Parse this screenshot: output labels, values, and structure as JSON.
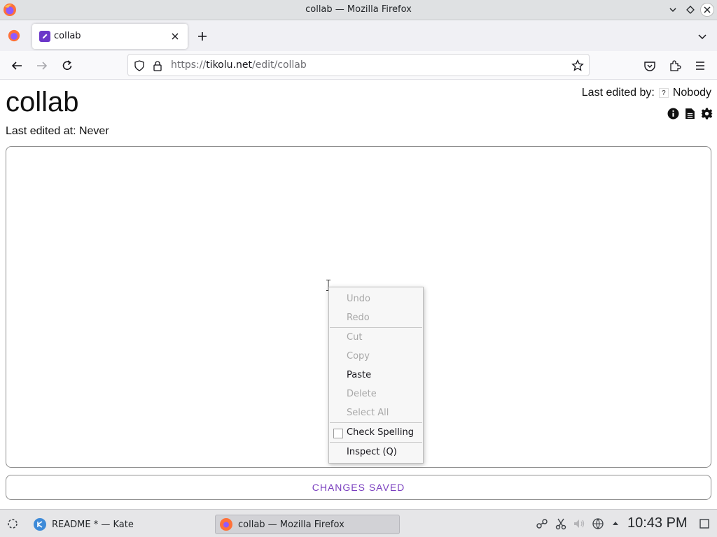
{
  "window": {
    "title": "collab — Mozilla Firefox"
  },
  "tabs": [
    {
      "label": "collab",
      "favicon": "pencil-favicon-icon"
    }
  ],
  "navbar": {
    "url_prefix": "https://",
    "url_host": "tikolu.net",
    "url_path": "/edit/collab"
  },
  "page": {
    "title": "collab",
    "last_edited_at_label": "Last edited at: Never",
    "last_edited_by_label": "Last edited by:",
    "last_edited_by_badge": "?",
    "last_edited_by_user": "Nobody",
    "status": "CHANGES SAVED",
    "accent_color": "#7a3fbf"
  },
  "context_menu": {
    "items": [
      {
        "label": "Undo",
        "enabled": false
      },
      {
        "label": "Redo",
        "enabled": false
      },
      {
        "label": "Cut",
        "enabled": false
      },
      {
        "label": "Copy",
        "enabled": false
      },
      {
        "label": "Paste",
        "enabled": true
      },
      {
        "label": "Delete",
        "enabled": false
      },
      {
        "label": "Select All",
        "enabled": false
      },
      {
        "label": "Check Spelling",
        "enabled": true,
        "checked": false
      },
      {
        "label": "Inspect (Q)",
        "enabled": true
      }
    ]
  },
  "taskbar": {
    "tasks": [
      {
        "label": "README * — Kate",
        "icon": "kate-icon",
        "active": false
      },
      {
        "label": "collab — Mozilla Firefox",
        "icon": "firefox-icon",
        "active": true
      }
    ],
    "clock": "10:43 PM"
  }
}
